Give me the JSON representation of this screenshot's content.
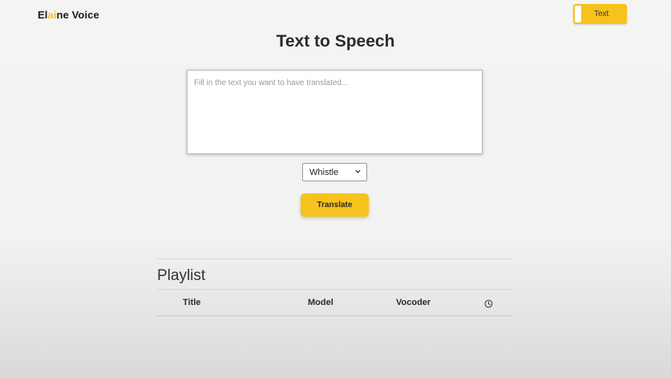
{
  "header": {
    "brand_prefix": "El",
    "brand_accent": "ai",
    "brand_suffix": "ne Voice",
    "mode_toggle_label": "Text"
  },
  "main": {
    "title": "Text to Speech",
    "text_input": {
      "value": "",
      "placeholder": "Fill in the text you want to have translated..."
    },
    "model_select": {
      "selected": "Whistle"
    },
    "translate_label": "Translate"
  },
  "playlist": {
    "title": "Playlist",
    "columns": [
      "Title",
      "Model",
      "Vocoder"
    ],
    "time_column_icon": "clock-icon",
    "rows": []
  },
  "colors": {
    "accent": "#f6c21b",
    "brand_accent": "#f5c518",
    "background": "#f3f3f1"
  }
}
